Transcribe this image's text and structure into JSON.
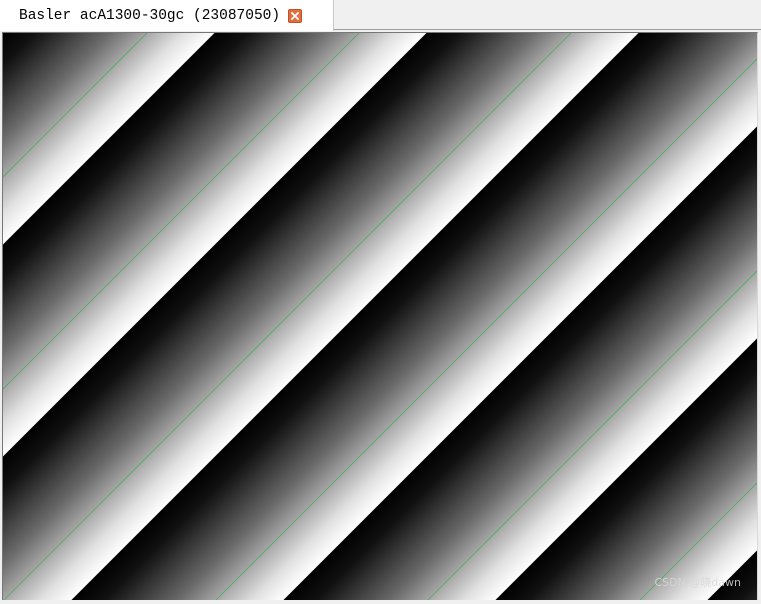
{
  "window": {
    "tab": {
      "title": "Basler acA1300-30gc (23087050)",
      "close_icon": "close-icon",
      "close_color": "#e2703e"
    }
  },
  "image": {
    "content": "diagonal sawtooth gradient stripes",
    "stripe_colors": [
      "#000000",
      "#ffffff"
    ],
    "edge_color": "#2fa84f"
  },
  "watermark": {
    "text": "CSDN @晓dawn"
  }
}
